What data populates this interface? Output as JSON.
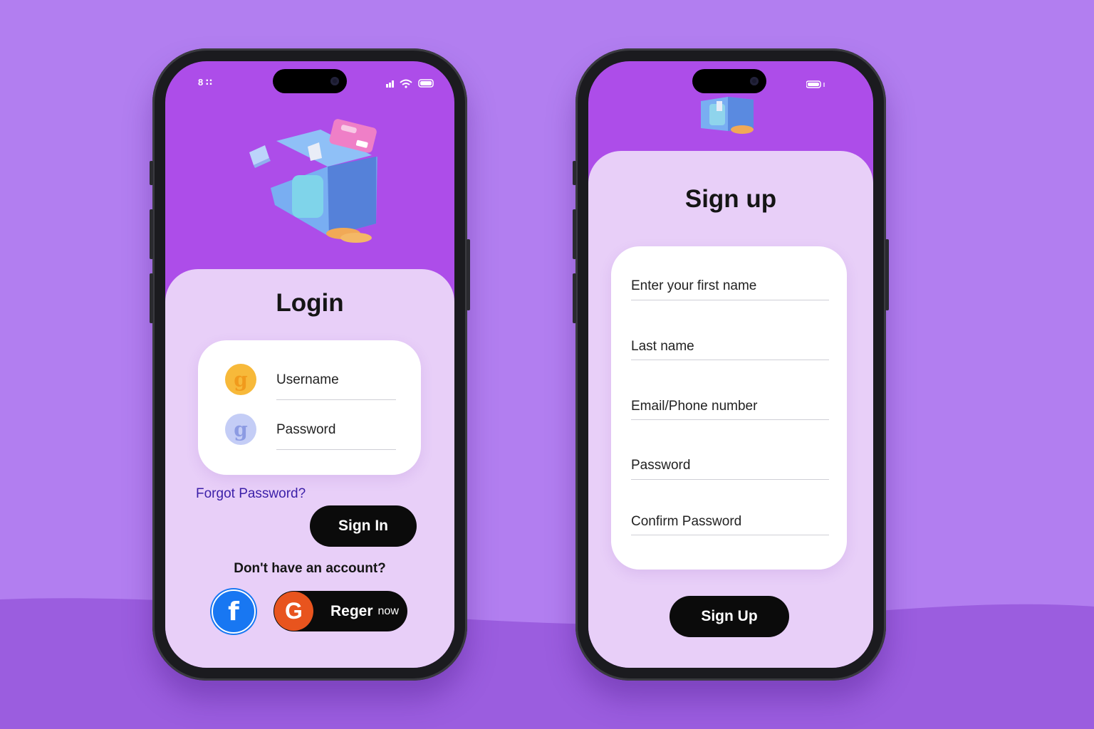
{
  "login": {
    "status_left": "8 ∷",
    "title": "Login",
    "username_placeholder": "Username",
    "password_placeholder": "Password",
    "forgot_link": "Forgot Password?",
    "signin_button": "Sign In",
    "no_account_text": "Don't have an account?",
    "register_main": "Reger",
    "register_suffix": "now",
    "facebook_icon_glyph": "f",
    "google_icon_glyph": "G"
  },
  "signup": {
    "title": "Sign up",
    "fields": [
      "Enter your first name",
      "Last name",
      "Email/Phone number",
      "Password",
      "Confirm Password"
    ],
    "signup_button": "Sign Up"
  },
  "colors": {
    "background": "#b27ef0",
    "header_purple": "#ad4de9",
    "sheet_lavender": "#e8cff8",
    "button_black": "#0b0b0b",
    "link_blue": "#3b1fa8",
    "facebook_blue": "#1877f2",
    "google_red": "#e8541e"
  }
}
